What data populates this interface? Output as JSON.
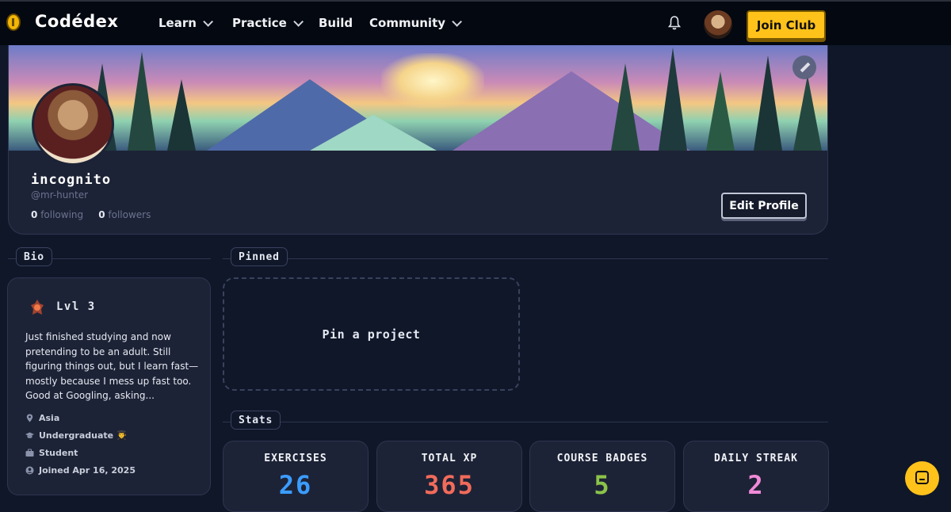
{
  "nav": {
    "brand": "Codédex",
    "items": [
      {
        "label": "Learn",
        "has_dropdown": true
      },
      {
        "label": "Practice",
        "has_dropdown": true
      },
      {
        "label": "Build",
        "has_dropdown": false
      },
      {
        "label": "Community",
        "has_dropdown": true
      }
    ],
    "join_label": "Join Club",
    "accent": "#ffc21a"
  },
  "profile": {
    "name": "incognito",
    "handle": "@mr-hunter",
    "following_count": "0",
    "following_label": "following",
    "followers_count": "0",
    "followers_label": "followers",
    "edit_label": "Edit Profile"
  },
  "bio": {
    "section_label": "Bio",
    "level": "Lvl 3",
    "text": "Just finished studying and now pretending to be an adult. Still figuring things out, but I learn fast—mostly because I mess up fast too. Good at Googling, asking...",
    "location": "Asia",
    "education": "Undergraduate 👨‍🎓",
    "occupation": "Student",
    "joined": "Joined Apr 16, 2025"
  },
  "pinned": {
    "section_label": "Pinned",
    "placeholder": "Pin a project"
  },
  "stats": {
    "section_label": "Stats",
    "items": [
      {
        "label": "EXERCISES",
        "value": "26",
        "color": "#3b9cff"
      },
      {
        "label": "TOTAL XP",
        "value": "365",
        "color": "#f26b5b"
      },
      {
        "label": "COURSE BADGES",
        "value": "5",
        "color": "#8bc34a"
      },
      {
        "label": "DAILY STREAK",
        "value": "2",
        "color": "#f08ad8"
      }
    ]
  }
}
